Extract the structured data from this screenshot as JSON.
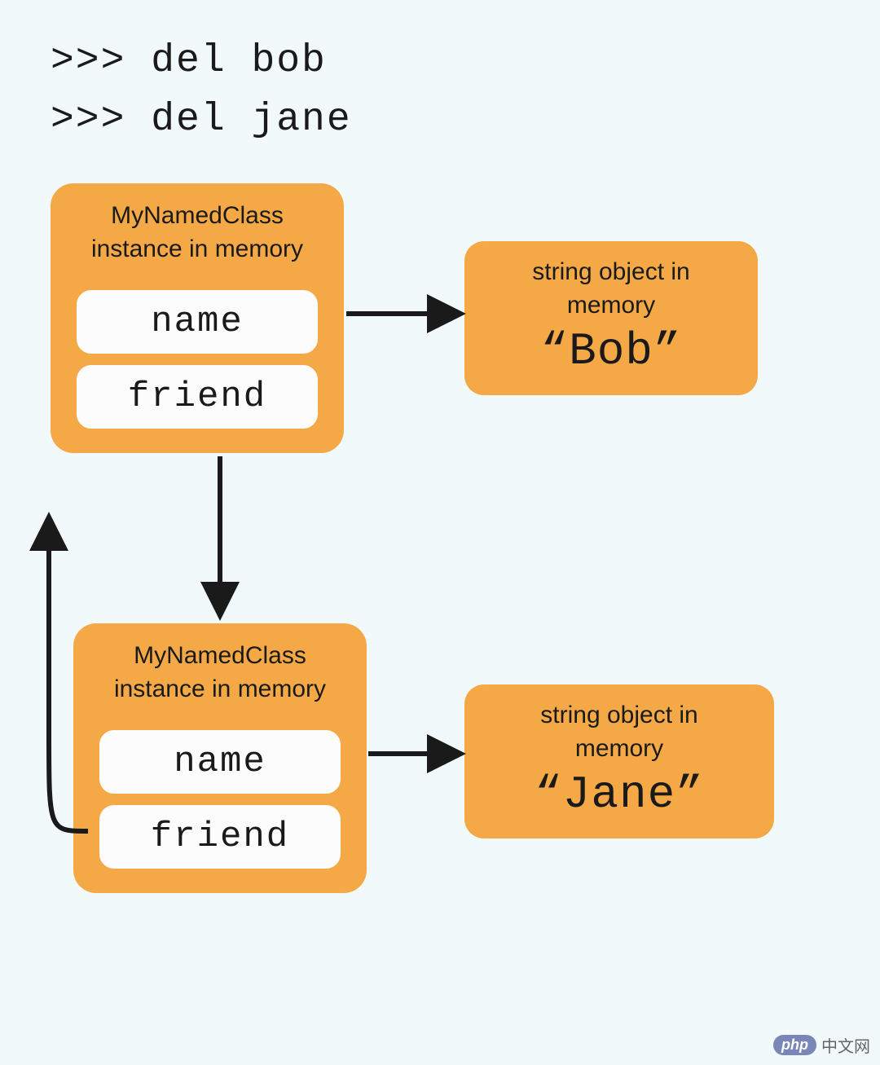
{
  "code": {
    "line1": ">>> del bob",
    "line2": ">>> del jane"
  },
  "instance1": {
    "title_line1": "MyNamedClass",
    "title_line2": "instance in memory",
    "attr1": "name",
    "attr2": "friend"
  },
  "string1": {
    "title_line1": "string object in",
    "title_line2": "memory",
    "value": "“Bob”"
  },
  "instance2": {
    "title_line1": "MyNamedClass",
    "title_line2": "instance in memory",
    "attr1": "name",
    "attr2": "friend"
  },
  "string2": {
    "title_line1": "string object in",
    "title_line2": "memory",
    "value": "“Jane”"
  },
  "watermark": {
    "badge": "php",
    "text": "中文网"
  }
}
